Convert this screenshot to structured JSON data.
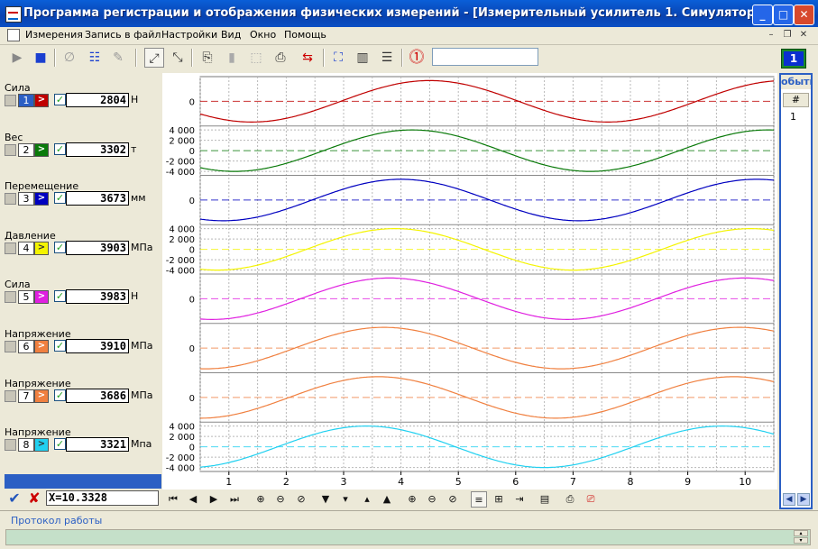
{
  "window": {
    "title": "Программа регистрации и отображения физических измерений - [Измерительный усилитель 1. Симулятор]",
    "btn_min": "_",
    "btn_max": "□",
    "btn_close": "✕"
  },
  "menu": [
    "Измерения",
    "Запись в файл",
    "Настройки",
    "Вид",
    "Окно",
    "Помощь"
  ],
  "mdi": {
    "min": "–",
    "restore": "❐",
    "close": "✕"
  },
  "toolbar": {
    "indicator": "1"
  },
  "channels": [
    {
      "name": "Сила",
      "num": "1",
      "value": "2804",
      "unit": "Н",
      "color": "#c00000"
    },
    {
      "name": "Вес",
      "num": "2",
      "value": "3302",
      "unit": "т",
      "color": "#0a7a0a"
    },
    {
      "name": "Перемещение",
      "num": "3",
      "value": "3673",
      "unit": "мм",
      "color": "#0000c0"
    },
    {
      "name": "Давление",
      "num": "4",
      "value": "3903",
      "unit": "МПа",
      "color": "#f4f400"
    },
    {
      "name": "Сила",
      "num": "5",
      "value": "3983",
      "unit": "Н",
      "color": "#e020e0"
    },
    {
      "name": "Напряжение",
      "num": "6",
      "value": "3910",
      "unit": "МПа",
      "color": "#f08040"
    },
    {
      "name": "Напряжение",
      "num": "7",
      "value": "3686",
      "unit": "МПа",
      "color": "#f08040"
    },
    {
      "name": "Напряжение",
      "num": "8",
      "value": "3321",
      "unit": "Mпа",
      "color": "#20d0f0"
    }
  ],
  "cursor": {
    "x_value": "X=10.3328"
  },
  "events": {
    "header": "обыти",
    "col": "#",
    "row1": "1"
  },
  "protocol": {
    "title": "Протокол работы"
  },
  "chart_data": {
    "type": "line",
    "xlim": [
      0.5,
      10.5
    ],
    "x_ticks": [
      "1",
      "2",
      "3",
      "4",
      "5",
      "6",
      "7",
      "8",
      "9",
      "10"
    ],
    "grid": true,
    "series": [
      {
        "color": "#c00000",
        "y_ticks": [
          "0"
        ],
        "phase": 4.5
      },
      {
        "color": "#0a7a0a",
        "y_ticks": [
          "4 000",
          "2 000",
          "0",
          "-2 000",
          "-4 000"
        ],
        "phase": 4.2
      },
      {
        "color": "#0000c0",
        "y_ticks": [
          "0"
        ],
        "phase": 4.0
      },
      {
        "color": "#f4f400",
        "y_ticks": [
          "4 000",
          "2 000",
          "0",
          "-2 000",
          "-4 000"
        ],
        "phase": 3.9
      },
      {
        "color": "#e020e0",
        "y_ticks": [
          "0"
        ],
        "phase": 3.8
      },
      {
        "color": "#f08040",
        "y_ticks": [
          "0"
        ],
        "phase": 3.7
      },
      {
        "color": "#f08040",
        "y_ticks": [
          "0"
        ],
        "phase": 3.6
      },
      {
        "color": "#20d0f0",
        "y_ticks": [
          "4 000",
          "2 000",
          "0",
          "-2 000",
          "-4 000"
        ],
        "phase": 3.4
      }
    ]
  }
}
